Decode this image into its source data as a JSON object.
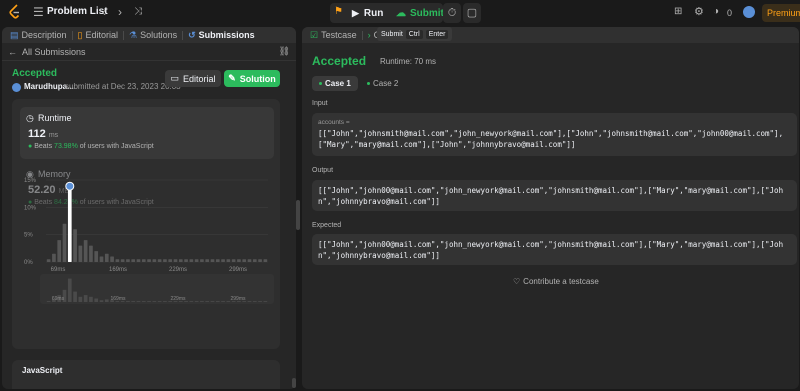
{
  "topbar": {
    "problem_list": "Problem List",
    "run": "Run",
    "submit": "Submit",
    "streak": "0",
    "premium": "Premium"
  },
  "left": {
    "tabs": [
      "Description",
      "Editorial",
      "Solutions",
      "Submissions"
    ],
    "back_label": "All Submissions",
    "status": "Accepted",
    "user": "Marudhupa...",
    "submitted": "submitted at Dec 23, 2023 20:03",
    "editorial_btn": "Editorial",
    "solution_btn": "Solution",
    "runtime": {
      "title": "Runtime",
      "value": "112",
      "unit": "ms",
      "beats_prefix": "Beats",
      "beats_pct": "73.98%",
      "beats_suffix": "of users with JavaScript"
    },
    "memory": {
      "title": "Memory",
      "value": "52.20",
      "unit": "MB",
      "beats_prefix": "Beats",
      "beats_pct": "84.24%",
      "beats_suffix": "of users with JavaScript"
    },
    "language": "JavaScript"
  },
  "chart_data": {
    "type": "bar",
    "y_ticks": [
      "15%",
      "10%",
      "5%",
      "0%"
    ],
    "ylim": [
      0,
      15
    ],
    "x_ticks": [
      "69ms",
      "169ms",
      "229ms",
      "299ms"
    ],
    "mini_x_ticks": [
      "69ms",
      "169ms",
      "229ms",
      "299ms"
    ],
    "values": [
      0.5,
      1.5,
      4,
      7,
      13.5,
      6,
      3,
      4,
      3,
      2,
      1,
      1.5,
      1,
      0.5,
      0.5,
      0.5,
      0.5,
      0.5,
      0.5,
      0.5,
      0.5,
      0.5,
      0.5,
      0.5,
      0.5,
      0.5,
      0.5,
      0.5,
      0.5,
      0.5,
      0.5,
      0.5,
      0.5,
      0.5,
      0.5,
      0.5,
      0.5,
      0.5,
      0.5,
      0.5,
      0.5,
      0.5
    ],
    "highlight_index": 4
  },
  "right": {
    "tabs": [
      "Testcase",
      "Co"
    ],
    "tooltip": {
      "label": "Submit",
      "keys": [
        "Ctrl",
        "Enter"
      ]
    },
    "status": "Accepted",
    "runtime": "Runtime: 70 ms",
    "cases": [
      "Case 1",
      "Case 2"
    ],
    "input_label": "Input",
    "input_sub": "accounts =",
    "input_line1": "[[\"John\",\"johnsmith@mail.com\",\"john_newyork@mail.com\"],[\"John\",\"johnsmith@mail.com\",\"john00@mail.com\"],",
    "input_line2": "[\"Mary\",\"mary@mail.com\"],[\"John\",\"johnnybravo@mail.com\"]]",
    "output_label": "Output",
    "output_line1": "[[\"John\",\"john00@mail.com\",\"john_newyork@mail.com\",\"johnsmith@mail.com\"],[\"Mary\",\"mary@mail.com\"],[\"Joh",
    "output_line2": "n\",\"johnnybravo@mail.com\"]]",
    "expected_label": "Expected",
    "expected_line1": "[[\"John\",\"john00@mail.com\",\"john_newyork@mail.com\",\"johnsmith@mail.com\"],[\"Mary\",\"mary@mail.com\"],[\"Joh",
    "expected_line2": "n\",\"johnnybravo@mail.com\"]]",
    "contribute": "Contribute a testcase"
  }
}
